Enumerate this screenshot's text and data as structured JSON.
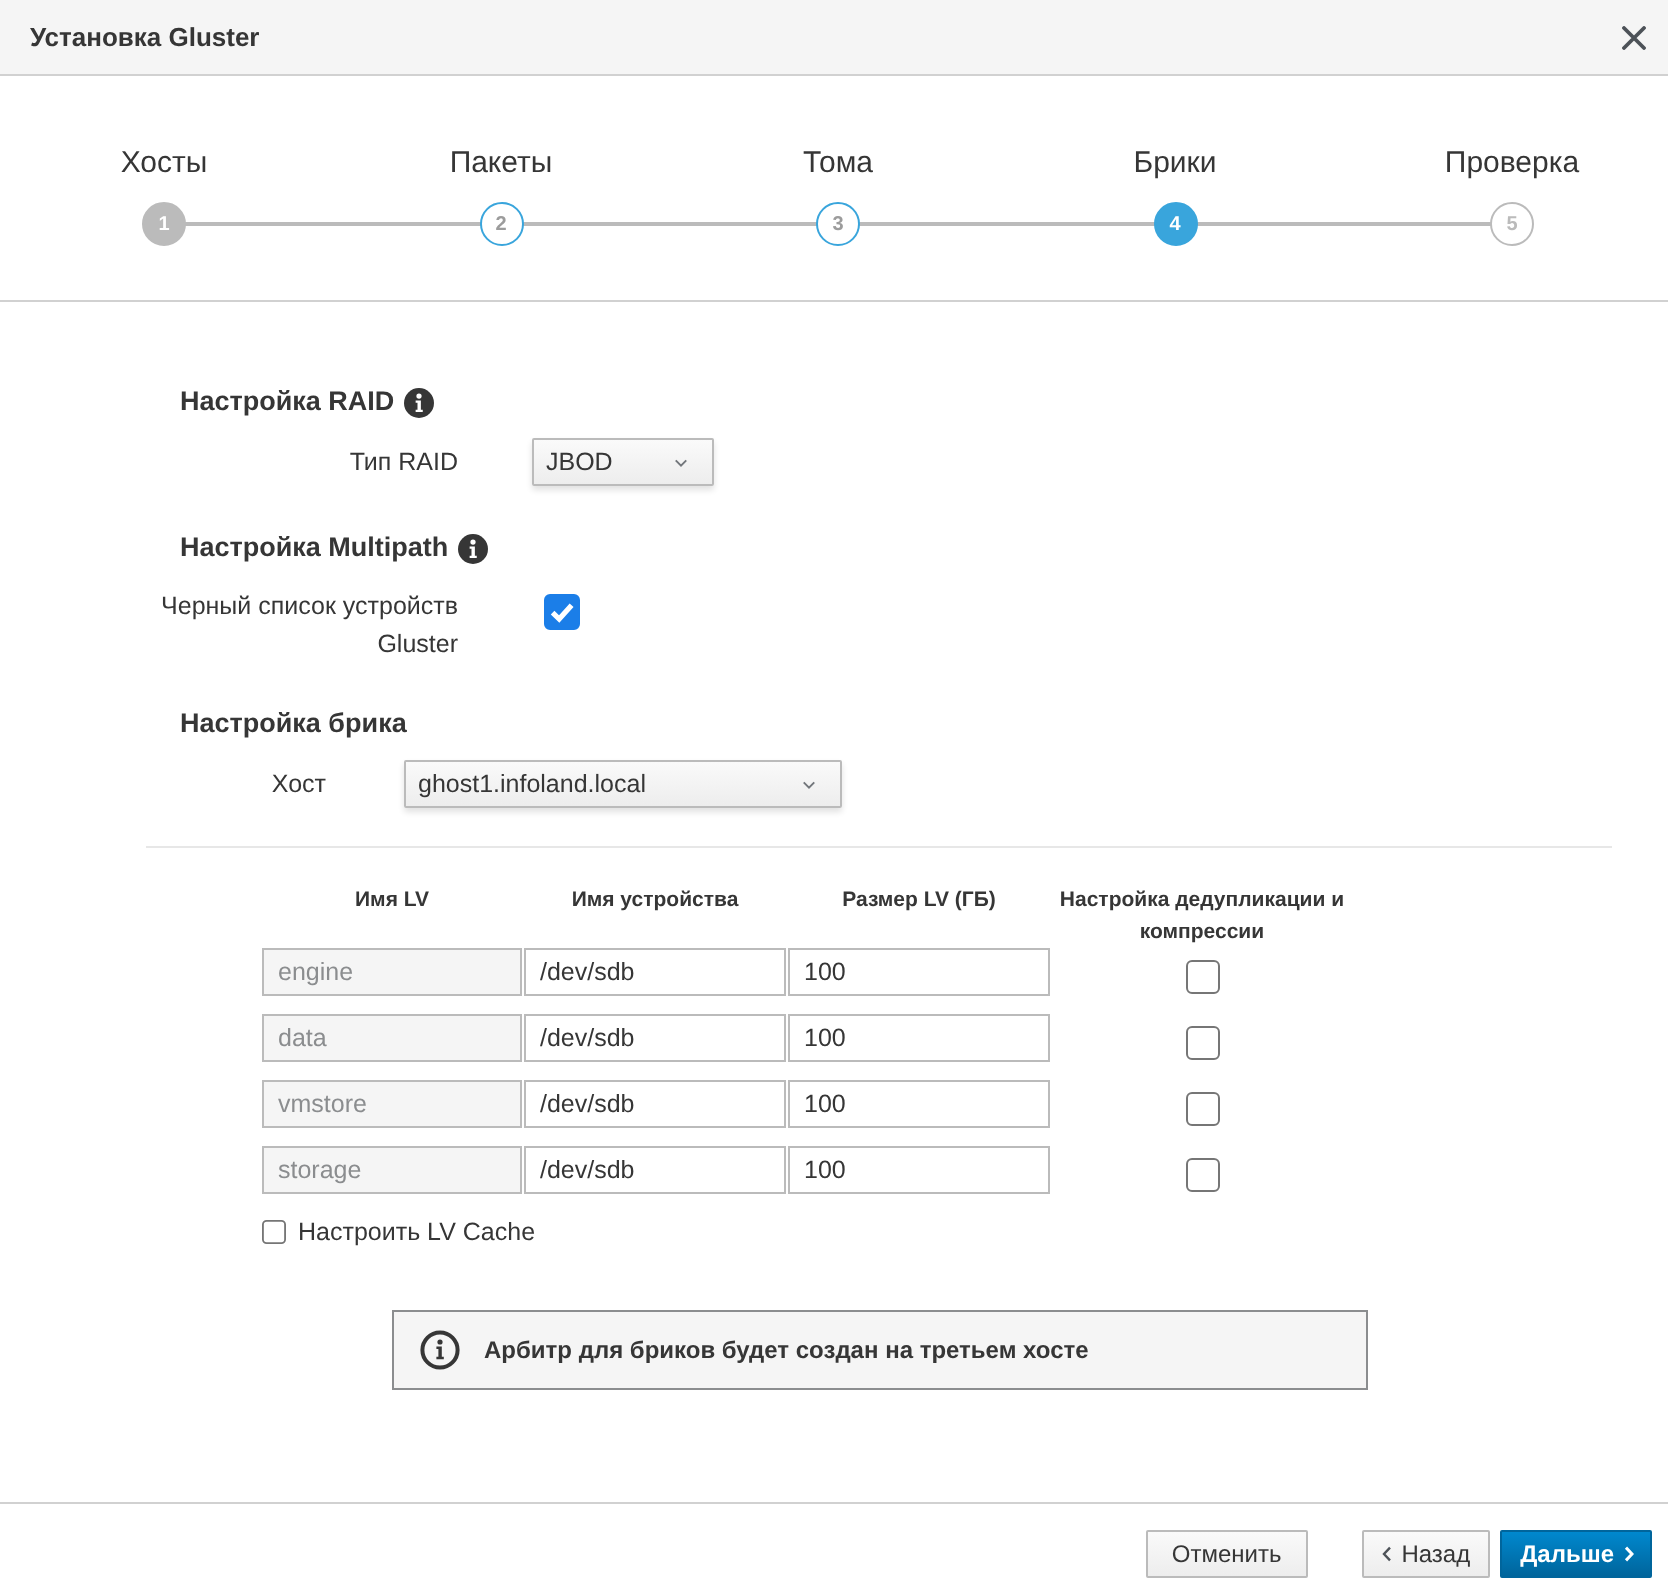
{
  "dialog": {
    "title": "Установка Gluster"
  },
  "steps": [
    {
      "label": "Хосты",
      "number": "1",
      "selected": false,
      "disabled": true,
      "visited": false
    },
    {
      "label": "Пакеты",
      "number": "2",
      "selected": false,
      "disabled": false,
      "visited": true
    },
    {
      "label": "Тома",
      "number": "3",
      "selected": false,
      "disabled": false,
      "visited": true
    },
    {
      "label": "Брики",
      "number": "4",
      "selected": true,
      "disabled": false,
      "visited": true
    },
    {
      "label": "Проверка",
      "number": "5",
      "selected": false,
      "disabled": false,
      "visited": false
    }
  ],
  "raid": {
    "heading": "Настройка RAID",
    "type_label": "Тип RAID",
    "type_value": "JBOD"
  },
  "multipath": {
    "heading": "Настройка Multipath",
    "blacklist_label": "Черный список устройств Gluster",
    "blacklist_checked": true
  },
  "brick": {
    "heading": "Настройка брика",
    "host_label": "Хост",
    "host_value": "ghost1.infoland.local"
  },
  "table": {
    "columns": [
      "Имя LV",
      "Имя устройства",
      "Размер LV (ГБ)",
      "Настройка дедупликации и компрессии"
    ],
    "rows": [
      {
        "lv_name": "engine",
        "lv_name_readonly": true,
        "device": "/dev/sdb",
        "size": "100",
        "dedup_checked": false
      },
      {
        "lv_name": "data",
        "lv_name_readonly": true,
        "device": "/dev/sdb",
        "size": "100",
        "dedup_checked": false
      },
      {
        "lv_name": "vmstore",
        "lv_name_readonly": true,
        "device": "/dev/sdb",
        "size": "100",
        "dedup_checked": false
      },
      {
        "lv_name": "storage",
        "lv_name_readonly": true,
        "device": "/dev/sdb",
        "size": "100",
        "dedup_checked": false
      }
    ]
  },
  "lv_cache": {
    "label": "Настроить LV Cache",
    "checked": false
  },
  "alert": {
    "text": "Арбитр для бриков будет создан на третьем хосте"
  },
  "buttons": [
    {
      "label": "Отменить",
      "kind": "default"
    },
    {
      "label": "Назад",
      "kind": "back"
    },
    {
      "label": "Дальше",
      "kind": "primary"
    }
  ]
}
